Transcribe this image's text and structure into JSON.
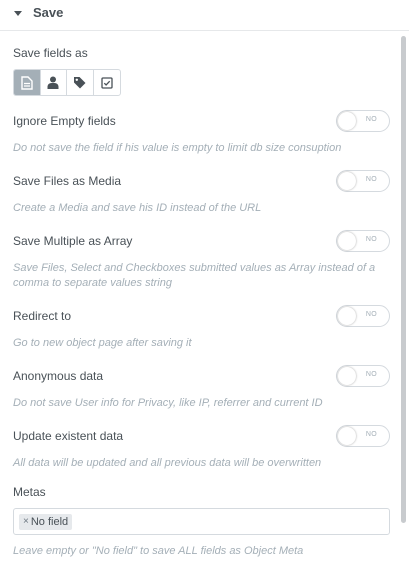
{
  "section": {
    "title": "Save"
  },
  "save_fields_as": {
    "label": "Save fields as",
    "options": [
      {
        "icon": "document-icon",
        "active": true
      },
      {
        "icon": "user-icon",
        "active": false
      },
      {
        "icon": "tag-icon",
        "active": false
      },
      {
        "icon": "checkbox-icon",
        "active": false
      }
    ]
  },
  "settings": [
    {
      "label": "Ignore Empty fields",
      "toggle": "NO",
      "description": "Do not save the field if his value is empty to limit db size consuption"
    },
    {
      "label": "Save Files as Media",
      "toggle": "NO",
      "description": "Create a Media and save his ID instead of the URL"
    },
    {
      "label": "Save Multiple as Array",
      "toggle": "NO",
      "description": "Save Files, Select and Checkboxes submitted values as Array instead of a comma to separate values string"
    },
    {
      "label": "Redirect to",
      "toggle": "NO",
      "description": "Go to new object page after saving it"
    },
    {
      "label": "Anonymous data",
      "toggle": "NO",
      "description": "Do not save User info for Privacy, like IP, referrer and current ID"
    },
    {
      "label": "Update existent data",
      "toggle": "NO",
      "description": "All data will be updated and all previous data will be overwritten"
    }
  ],
  "metas": {
    "label": "Metas",
    "remove_symbol": "×",
    "tag": "No field",
    "description": "Leave empty or \"No field\" to save ALL fields as Object Meta"
  },
  "colors": {
    "text": "#495157",
    "muted": "#a4afb7",
    "border": "#d5dadf",
    "active_choice": "#a4afb7"
  }
}
